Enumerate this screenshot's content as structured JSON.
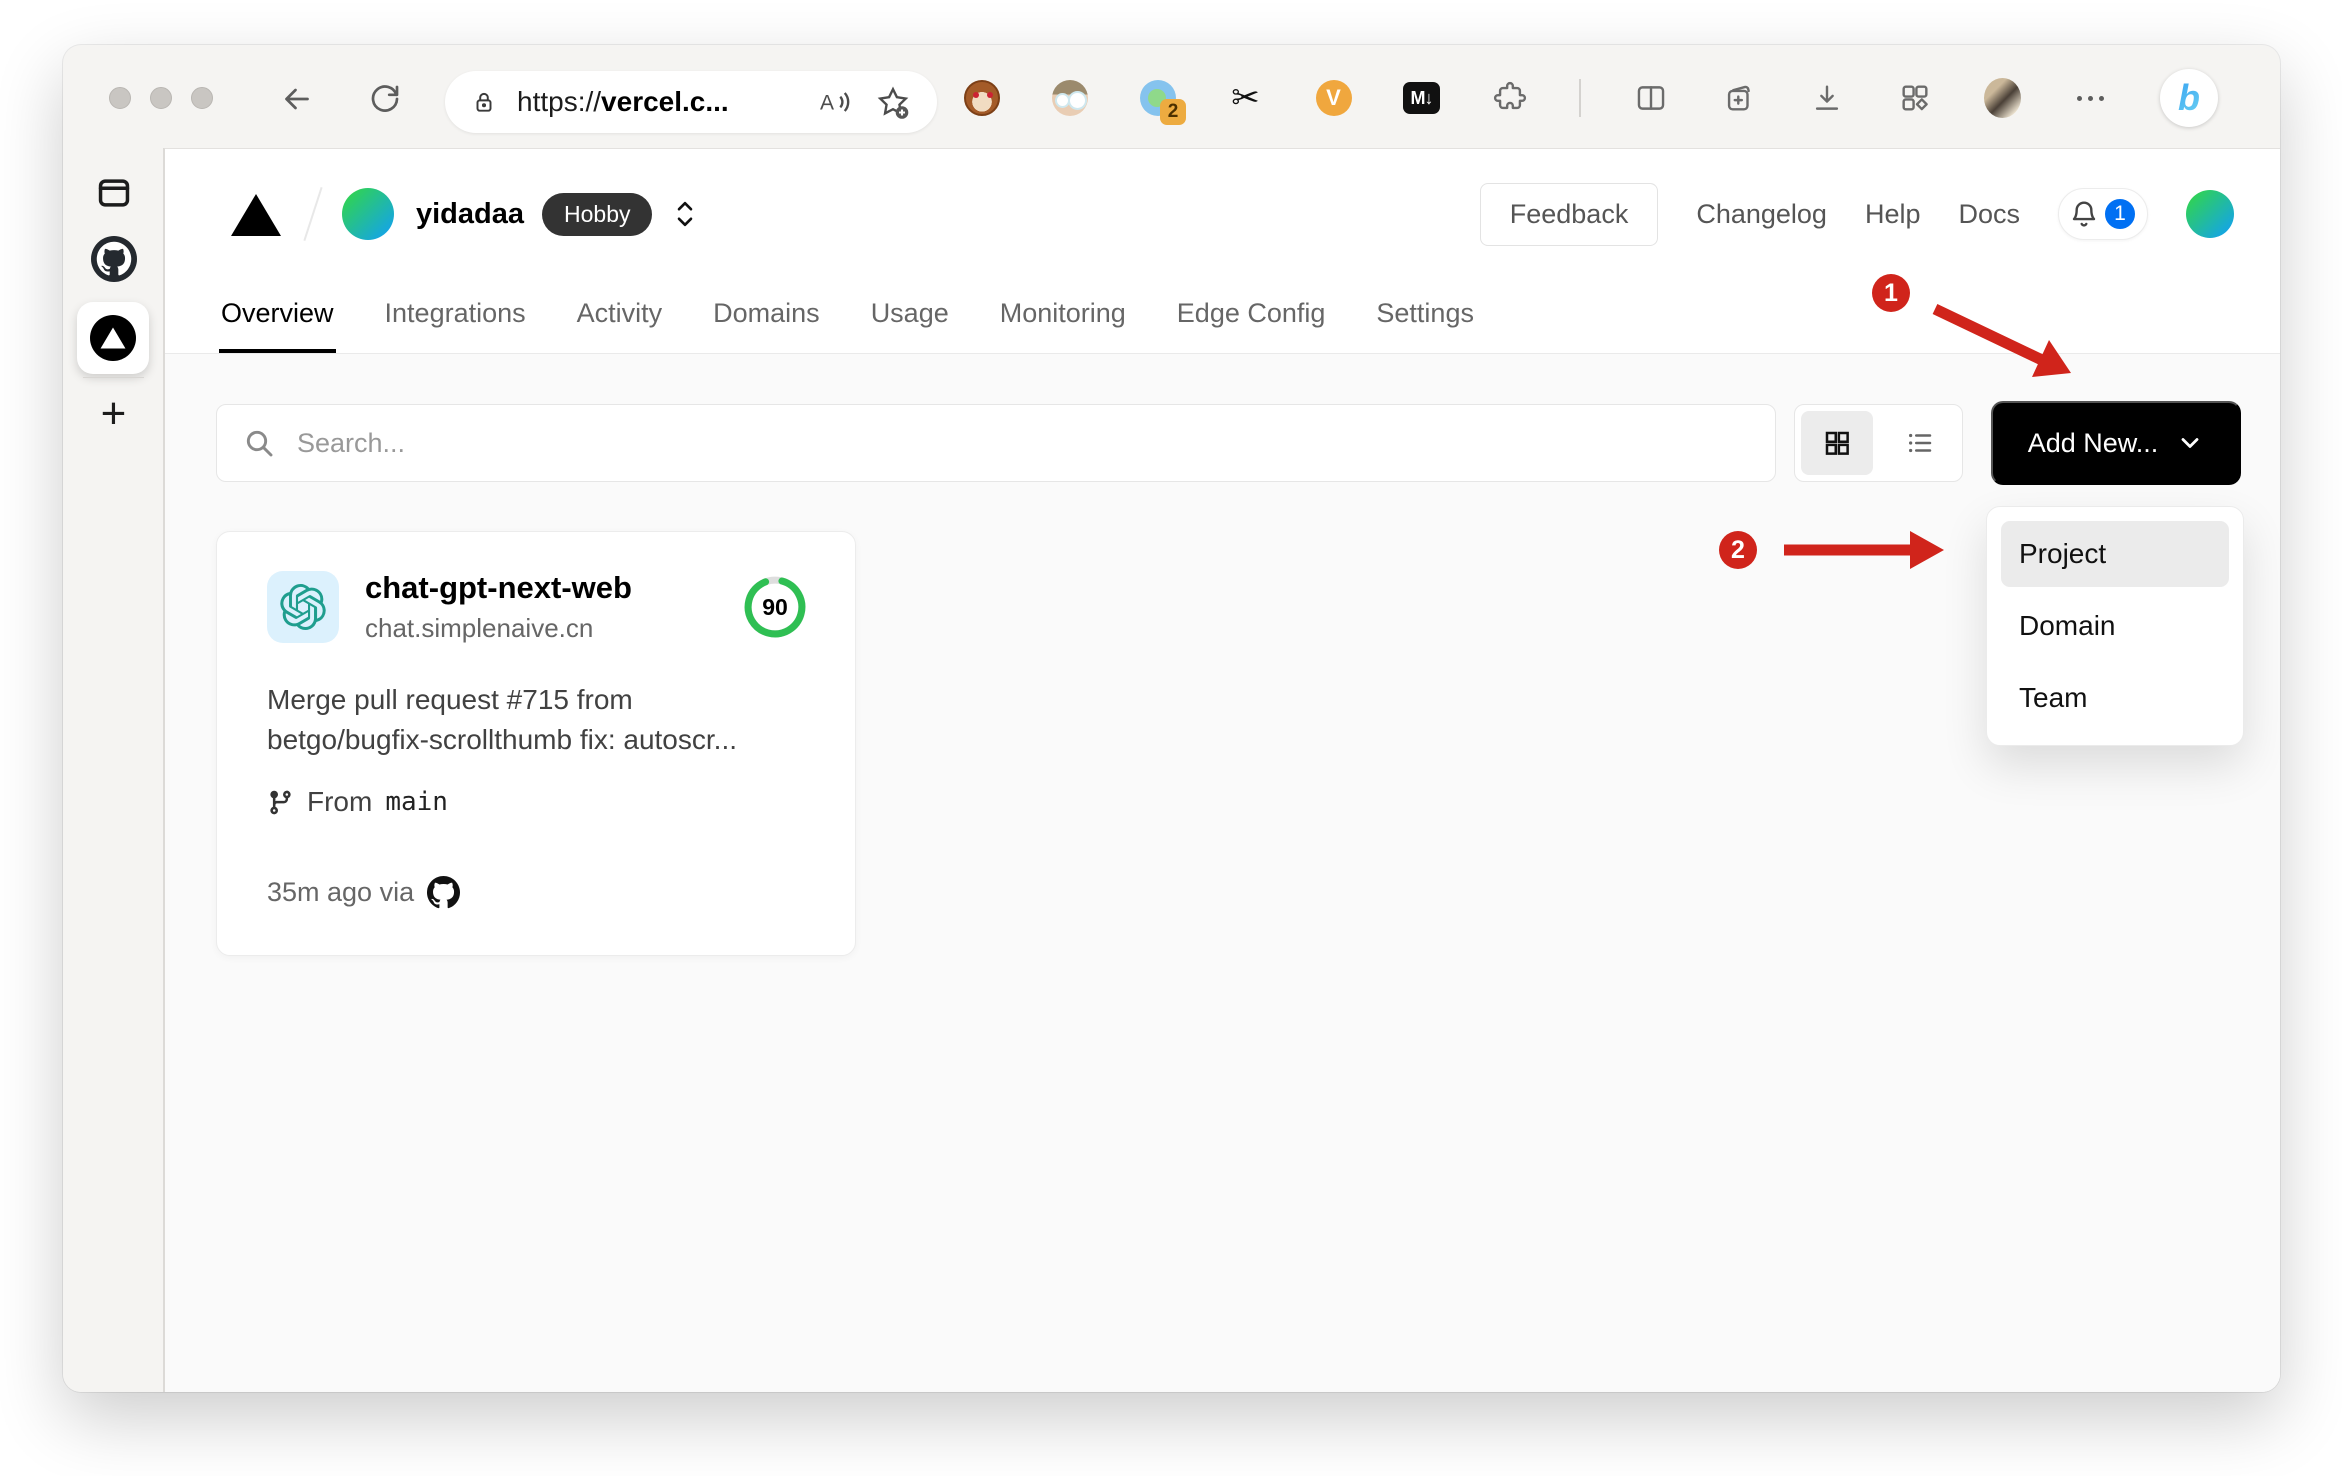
{
  "browser": {
    "url": {
      "protocol": "https://",
      "host": "vercel.c..."
    },
    "extensions": {
      "translate_badge": "2",
      "scissors_glyph": "✂",
      "v_label": "V",
      "markdown_label": "M↓",
      "bing_label": "b"
    }
  },
  "vercel": {
    "header": {
      "team": "yidadaa",
      "plan": "Hobby",
      "feedback": "Feedback",
      "links": [
        "Changelog",
        "Help",
        "Docs"
      ],
      "notification_count": "1"
    },
    "tabs": [
      "Overview",
      "Integrations",
      "Activity",
      "Domains",
      "Usage",
      "Monitoring",
      "Edge Config",
      "Settings"
    ],
    "active_tab": "Overview",
    "toolbar": {
      "search_placeholder": "Search...",
      "add_new": "Add New..."
    },
    "card": {
      "name": "chat-gpt-next-web",
      "domain": "chat.simplenaive.cn",
      "score": "90",
      "description_lines": [
        "Merge pull request #715 from",
        "betgo/bugfix-scrollthumb fix: autoscr..."
      ],
      "branch_label": "From",
      "branch_name": "main",
      "deployed": "35m ago via"
    },
    "dropdown": {
      "items": [
        "Project",
        "Domain",
        "Team"
      ],
      "highlighted": "Project"
    }
  },
  "annotations": {
    "step1": "1",
    "step2": "2",
    "arrow_color": "#d0241b"
  },
  "colors": {
    "accent_red": "#d0241b",
    "vercel_blue": "#0070f3",
    "ring_green": "#2fbf53",
    "openai_teal": "#1f9e8e",
    "body_bg": "#fafafa"
  }
}
